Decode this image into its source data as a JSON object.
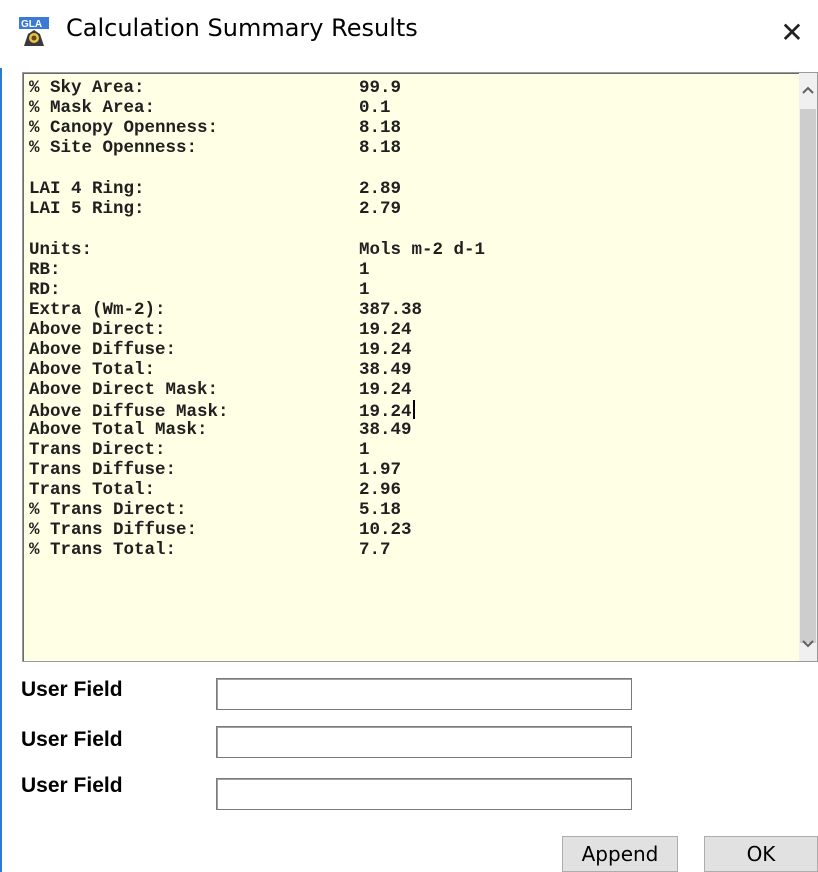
{
  "window": {
    "title": "Calculation Summary Results",
    "app_icon": "gla-app-icon",
    "close_glyph": "✕"
  },
  "results": {
    "groups": [
      [
        {
          "label": "% Sky Area:",
          "value": "99.9"
        },
        {
          "label": "% Mask Area:",
          "value": "0.1"
        },
        {
          "label": "% Canopy Openness:",
          "value": "8.18"
        },
        {
          "label": "% Site Openness:",
          "value": "8.18"
        }
      ],
      [
        {
          "label": "LAI 4 Ring:",
          "value": "2.89"
        },
        {
          "label": "LAI 5 Ring:",
          "value": "2.79"
        }
      ],
      [
        {
          "label": "Units:",
          "value": "Mols m-2 d-1"
        },
        {
          "label": "RB:",
          "value": "1"
        },
        {
          "label": "RD:",
          "value": "1"
        },
        {
          "label": "Extra (Wm-2):",
          "value": "387.38"
        },
        {
          "label": "Above Direct:",
          "value": "19.24"
        },
        {
          "label": "Above Diffuse:",
          "value": "19.24"
        },
        {
          "label": "Above Total:",
          "value": "38.49"
        },
        {
          "label": "Above Direct Mask:",
          "value": "19.24"
        },
        {
          "label": "Above Diffuse Mask:",
          "value": "19.24"
        },
        {
          "label": "Above Total Mask:",
          "value": "38.49"
        },
        {
          "label": "Trans Direct:",
          "value": "1"
        },
        {
          "label": "Trans Diffuse:",
          "value": "1.97"
        },
        {
          "label": "Trans Total:",
          "value": "2.96"
        },
        {
          "label": "% Trans Direct:",
          "value": "5.18"
        },
        {
          "label": "% Trans Diffuse:",
          "value": "10.23"
        },
        {
          "label": "% Trans Total:",
          "value": "7.7"
        }
      ]
    ]
  },
  "user_fields": [
    {
      "label": "User Field",
      "value": ""
    },
    {
      "label": "User Field",
      "value": ""
    },
    {
      "label": "User Field",
      "value": ""
    }
  ],
  "buttons": {
    "append": "Append",
    "ok": "OK"
  },
  "colors": {
    "results_background": "#ffffe6",
    "window_border": "#2a7bd4",
    "button_face": "#e1e1e1"
  }
}
